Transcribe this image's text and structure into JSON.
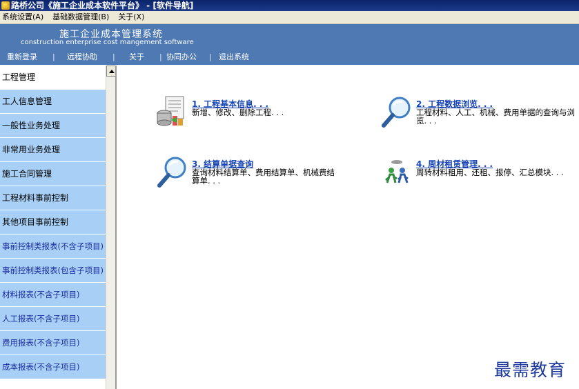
{
  "window": {
    "title": "路桥公司《施工企业成本软件平台》 - [软件导航]"
  },
  "menu": [
    "系统设置(A)",
    "基础数据管理(B)",
    "关于(X)"
  ],
  "banner": {
    "title": "施工企业成本管理系统",
    "subtitle": "construction enterprise cost mangement software",
    "nav": [
      "重新登录",
      "|",
      "远程协助",
      "|",
      "关于",
      "|",
      "协同办公",
      "|",
      "退出系统"
    ]
  },
  "sidebar": [
    "工程管理",
    "工人信息管理",
    "一般性业务处理",
    "非常用业务处理",
    "施工合同管理",
    "工程材料事前控制",
    "其他项目事前控制",
    "事前控制类报表(不含子项目)",
    "事前控制类报表(包含子项目)",
    "材料报表(不含子项目)",
    "人工报表(不含子项目)",
    "费用报表(不含子项目)",
    "成本报表(不含子项目)"
  ],
  "cards": [
    {
      "title": "1. 工程基本信息. . .",
      "desc": "新增、修改、删除工程. . .",
      "icon": "database-form-icon"
    },
    {
      "title": "2. 工程数据浏览. . .",
      "desc": "工程材料、人工、机械、费用单据的查询与浏览. . .",
      "icon": "magnifier-icon"
    },
    {
      "title": "3. 结算单据查询",
      "desc": "查询材料结算单、费用结算单、机械费结算单. . .",
      "icon": "magnifier-icon"
    },
    {
      "title": "4. 周材租赁管理. . .",
      "desc": "周转材料租用、还租、报停、汇总模块. . .",
      "icon": "people-icon"
    }
  ],
  "watermark": "最需教育"
}
